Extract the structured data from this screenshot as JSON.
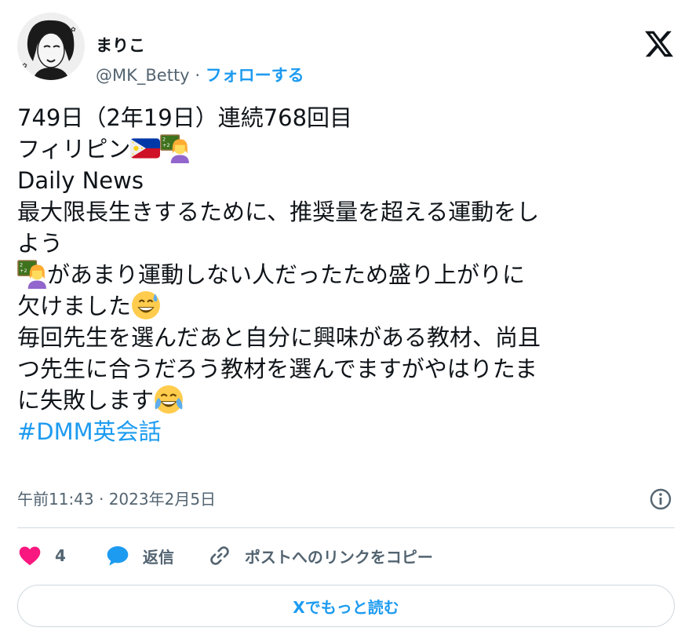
{
  "author": {
    "display_name": "まりこ",
    "handle": "@MK_Betty",
    "separator": "·",
    "follow_label": "フォローする"
  },
  "tweet": {
    "lines": {
      "l1": "749日（2年19日）連続768回目",
      "l2": "フィリピン",
      "l3": "Daily News",
      "l4": "最大限長生きするために、推奨量を超える運動をし",
      "l5": "よう",
      "l6": "があまり運動しない人だったため盛り上がりに",
      "l7": "欠けました",
      "l8": "毎回先生を選んだあと自分に興味がある教材、尚且",
      "l9": "つ先生に合うだろう教材を選んでますがやはりたま",
      "l10": "に失敗します"
    },
    "hashtag": "#DMM英会話",
    "emoji": {
      "flag": "philippines-flag",
      "teacher": "woman-teacher",
      "sweat_smile": "grinning-face-with-sweat",
      "tears_of_joy": "face-with-tears-of-joy"
    }
  },
  "meta": {
    "timestamp": "午前11:43 · 2023年2月5日"
  },
  "actions": {
    "like_count": "4",
    "reply_label": "返信",
    "copy_link_label": "ポストへのリンクをコピー"
  },
  "read_more_label": "Xでもっと読む",
  "colors": {
    "accent": "#1d9bf0",
    "like": "#f91880",
    "text": "#0f1419",
    "muted": "#536471",
    "border": "#cfd9de"
  }
}
